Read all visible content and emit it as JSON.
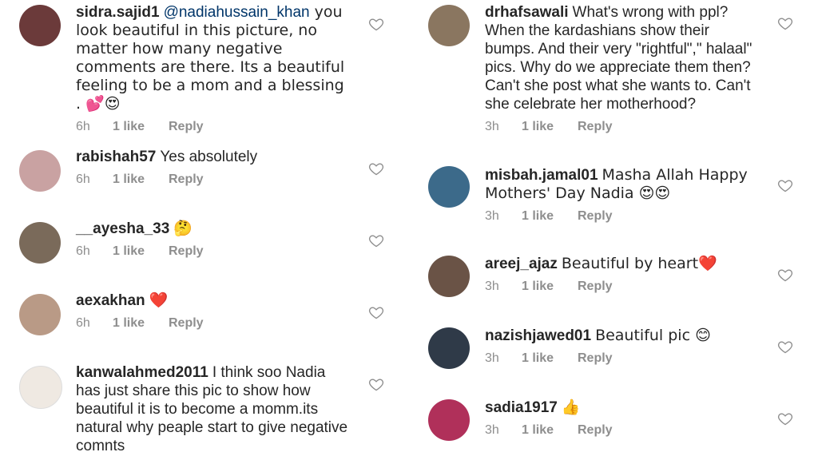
{
  "comments_left": [
    {
      "username": "sidra.sajid1",
      "mention": "@nadiahussain_khan",
      "text": " you look beautiful in this picture, no matter how many negative comments are there. Its a beautiful feeling to be a mom and a blessing . 💕😍",
      "time": "6h",
      "likes": "1 like",
      "reply": "Reply",
      "avatar_color": "#6b3a3a"
    },
    {
      "username": "rabishah57",
      "text": "Yes absolutely",
      "time": "6h",
      "likes": "1 like",
      "reply": "Reply",
      "avatar_color": "#c9a2a2"
    },
    {
      "username": "__ayesha_33",
      "text": "🤔",
      "time": "6h",
      "likes": "1 like",
      "reply": "Reply",
      "avatar_color": "#7a6a5a"
    },
    {
      "username": "aexakhan",
      "text": "❤️",
      "time": "6h",
      "likes": "1 like",
      "reply": "Reply",
      "avatar_color": "#b99a86"
    },
    {
      "username": "kanwalahmed2011",
      "text": "I think soo Nadia has just share this pic to show how beautiful it is to become a momm.its natural why peaple start to give negative comnts",
      "avatar_color": "#efe9e2"
    }
  ],
  "comments_right": [
    {
      "username": "drhafsawali",
      "text": "What's wrong with ppl? When the kardashians show their bumps. And their very \"rightful\",\" halaal\" pics. Why do we appreciate them then? Can't she post what she wants to. Can't she celebrate her motherhood?",
      "time": "3h",
      "likes": "1 like",
      "reply": "Reply",
      "avatar_color": "#8a7660"
    },
    {
      "username": "misbah.jamal01",
      "text": "Masha Allah Happy Mothers' Day Nadia 😍😍",
      "time": "3h",
      "likes": "1 like",
      "reply": "Reply",
      "avatar_color": "#3c6a8a"
    },
    {
      "username": "areej_ajaz",
      "text": "Beautiful by heart❤️",
      "time": "3h",
      "likes": "1 like",
      "reply": "Reply",
      "avatar_color": "#6a5346"
    },
    {
      "username": "nazishjawed01",
      "text": "Beautiful pic 😊",
      "time": "3h",
      "likes": "1 like",
      "reply": "Reply",
      "avatar_color": "#2f3a48"
    },
    {
      "username": "sadia1917",
      "text": "👍",
      "time": "3h",
      "likes": "1 like",
      "reply": "Reply",
      "avatar_color": "#b0305a"
    }
  ],
  "colors": {
    "heart_stroke": "#8e8e8e",
    "meta_text": "#8e8e8e",
    "mention": "#003569"
  }
}
